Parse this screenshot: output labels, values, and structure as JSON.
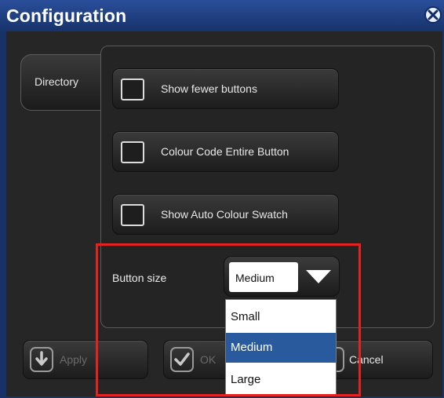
{
  "window": {
    "title": "Configuration",
    "close_icon": "close-circle-x-icon"
  },
  "tabs": [
    {
      "label": "Directory",
      "selected": true
    }
  ],
  "options": [
    {
      "label": "Show fewer buttons",
      "checked": false
    },
    {
      "label": "Colour Code Entire Button",
      "checked": false
    },
    {
      "label": "Show Auto Colour Swatch",
      "checked": false
    }
  ],
  "button_size": {
    "label": "Button size",
    "value": "Medium",
    "options": [
      "Small",
      "Medium",
      "Large"
    ],
    "selected_option": "Medium"
  },
  "footer": {
    "apply_label": "Apply",
    "ok_label": "OK",
    "cancel_label": "Cancel"
  },
  "colors": {
    "title_bar": "#17336b",
    "panel_bg": "#262626",
    "selected_item": "#2a5a9e",
    "annotation": "#e32222"
  }
}
